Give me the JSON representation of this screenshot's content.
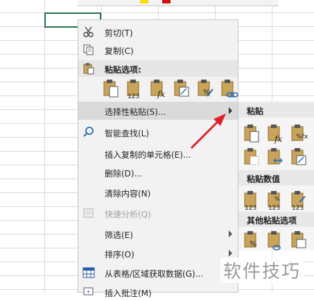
{
  "menu": {
    "items": [
      {
        "label": "剪切(T)",
        "icon": "scissors-icon"
      },
      {
        "label": "复制(C)",
        "icon": "copy-icon"
      },
      {
        "label": "粘贴选项:",
        "icon": "clipboard-icon"
      },
      {
        "label": "选择性粘贴(S)...",
        "icon": "",
        "has_submenu": true
      },
      {
        "label": "智能查找(L)",
        "icon": "smart-lookup-icon"
      },
      {
        "label": "插入复制的单元格(E)...",
        "icon": ""
      },
      {
        "label": "删除(D)...",
        "icon": ""
      },
      {
        "label": "清除内容(N)",
        "icon": ""
      },
      {
        "label": "快速分析(Q)",
        "icon": "quick-analysis-icon",
        "disabled": true
      },
      {
        "label": "筛选(E)",
        "icon": "",
        "has_submenu": true
      },
      {
        "label": "排序(O)",
        "icon": "",
        "has_submenu": true
      },
      {
        "label": "从表格/区域获取数据(G)...",
        "icon": "table-icon"
      },
      {
        "label": "插入批注(M)",
        "icon": "comment-icon"
      }
    ],
    "paste_options": [
      "paste-icon",
      "paste-values-icon",
      "paste-formulas-icon",
      "transpose-icon",
      "paste-formatting-icon",
      "paste-link-icon"
    ]
  },
  "submenu": {
    "sections": [
      {
        "label": "粘贴"
      },
      {
        "label": "粘贴数值"
      },
      {
        "label": "其他粘贴选项"
      }
    ]
  },
  "watermark": "软件技巧",
  "colors": {
    "accent": "#217346",
    "arrow": "#e0202a"
  }
}
